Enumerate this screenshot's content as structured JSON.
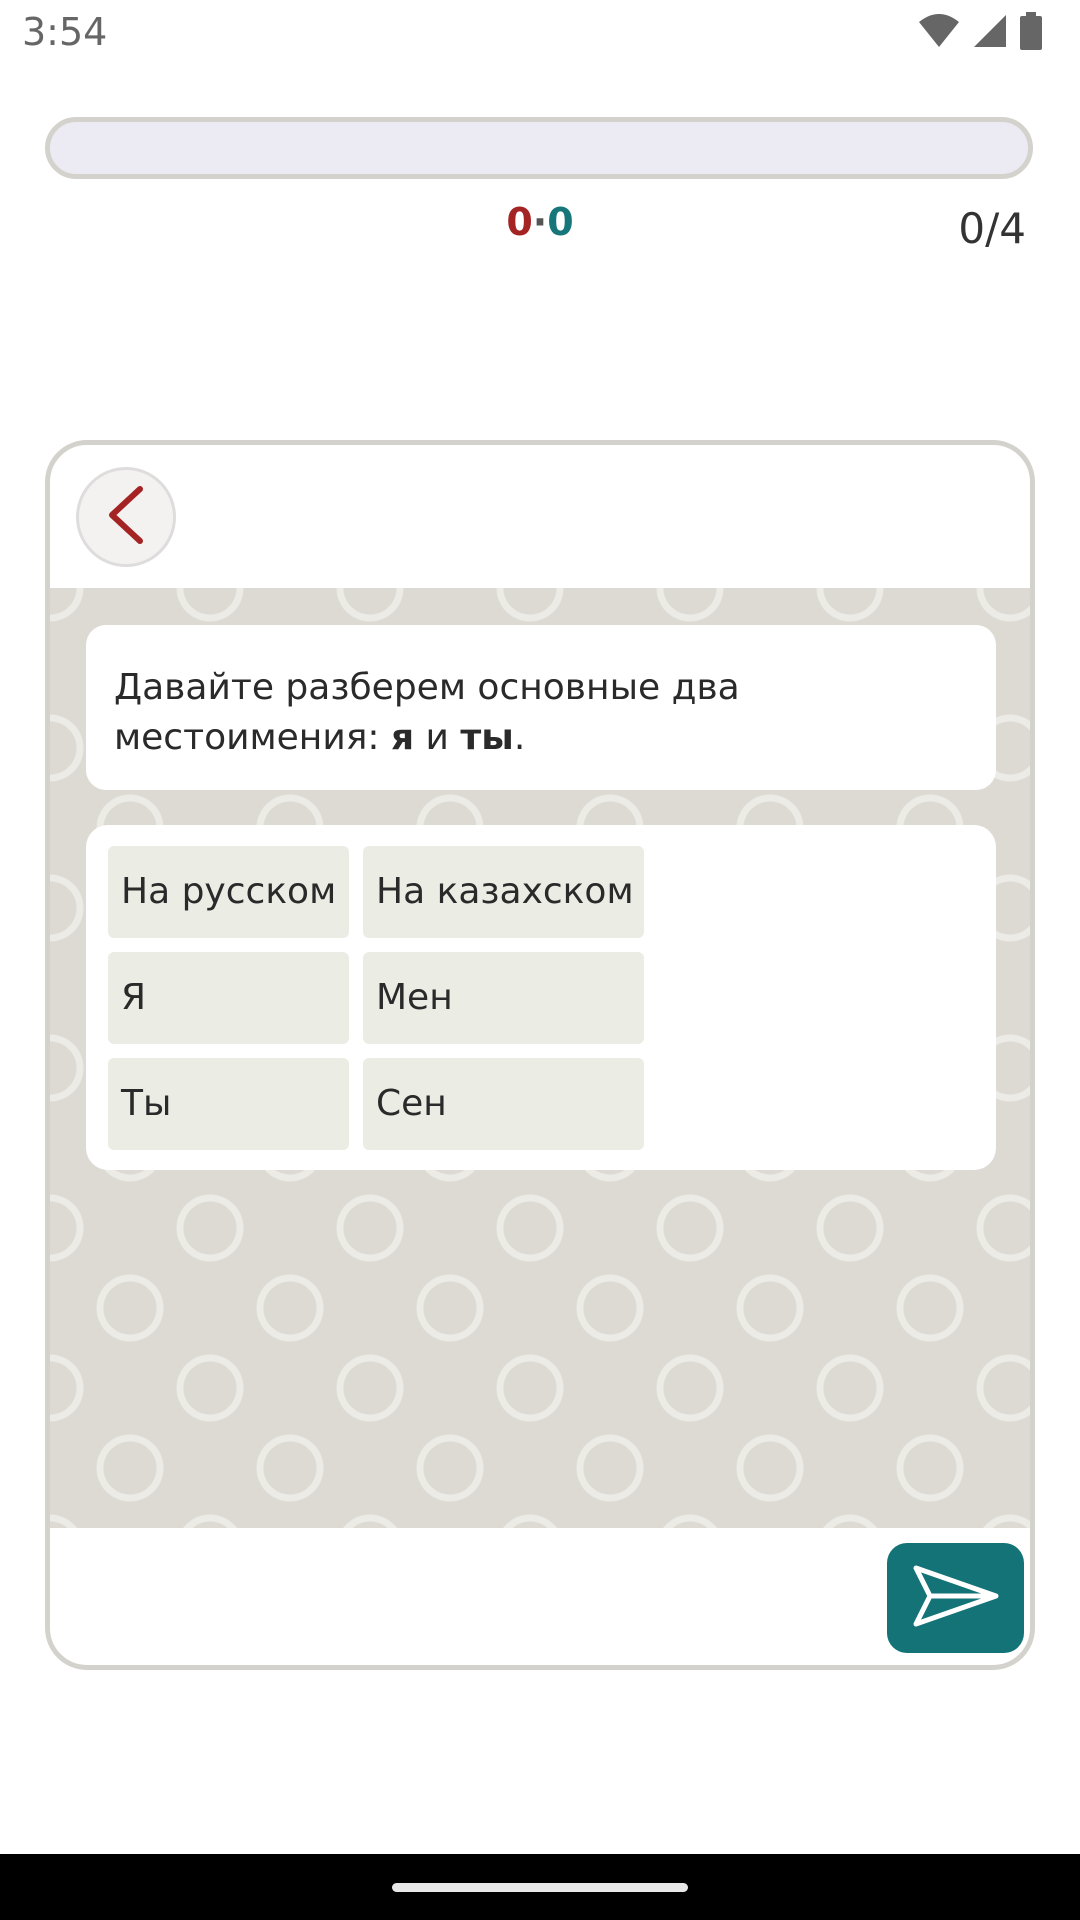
{
  "status_bar": {
    "time": "3:54",
    "icons": [
      "wifi-icon",
      "signal-icon",
      "battery-icon"
    ]
  },
  "progress": {
    "value": 0,
    "score_left": "0",
    "score_separator": "·",
    "score_right": "0",
    "counter": "0/4"
  },
  "message": {
    "text_before": "Давайте разберем основные два местоимения: ",
    "bold_1": "я",
    "text_middle": " и ",
    "bold_2": "ты",
    "text_after": "."
  },
  "table": {
    "headers": [
      "На русском",
      "На казахском"
    ],
    "rows": [
      [
        "Я",
        "Мен"
      ],
      [
        "Ты",
        "Сен"
      ]
    ]
  },
  "colors": {
    "accent_red": "#a42424",
    "accent_teal": "#137376",
    "cell_bg": "#ebede5",
    "chat_bg": "#dcdad2"
  },
  "icons": {
    "back": "chevron-left-icon",
    "send": "send-icon"
  }
}
